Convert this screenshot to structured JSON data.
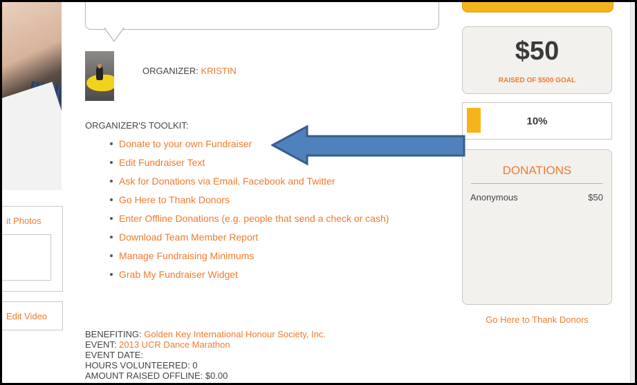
{
  "organizer": {
    "label": "ORGANIZER: ",
    "name": "KRISTIN"
  },
  "toolkit": {
    "title": "ORGANIZER'S TOOLKIT:",
    "items": [
      "Donate to your own Fundraiser",
      "Edit Fundraiser Text",
      "Ask for Donations via Email, Facebook and Twitter",
      "Go Here to Thank Donors",
      "Enter Offline Donations (e.g. people that send a check or cash)",
      "Download Team Member Report",
      "Manage Fundraising Minimums",
      "Grab My Fundraiser Widget"
    ]
  },
  "sidebar": {
    "photos_label": "it Photos",
    "video_label": "Edit Video"
  },
  "info": {
    "benefiting_label": "BENEFITING: ",
    "benefiting_value": "Golden Key International Honour Society, Inc.",
    "event_label": "EVENT: ",
    "event_value": "2013 UCR Dance Marathon",
    "event_date_label": "EVENT DATE:",
    "hours_volunteered": "HOURS VOLUNTEERED: 0",
    "amount_raised_offline": "AMOUNT RAISED OFFLINE: $0.00"
  },
  "fundraising": {
    "raised_amount": "$50",
    "goal_text": "RAISED OF $500 GOAL",
    "progress_percent_label": "10%",
    "progress_fraction": 0.1
  },
  "donations": {
    "title": "DONATIONS",
    "list": [
      {
        "name": "Anonymous",
        "amount": "$50"
      }
    ],
    "thank_link": "Go Here to Thank Donors"
  },
  "colors": {
    "link": "#f07a2c",
    "accent_yellow": "#f6b41c",
    "arrow_blue": "#4f81bd",
    "arrow_border": "#385d8a"
  }
}
